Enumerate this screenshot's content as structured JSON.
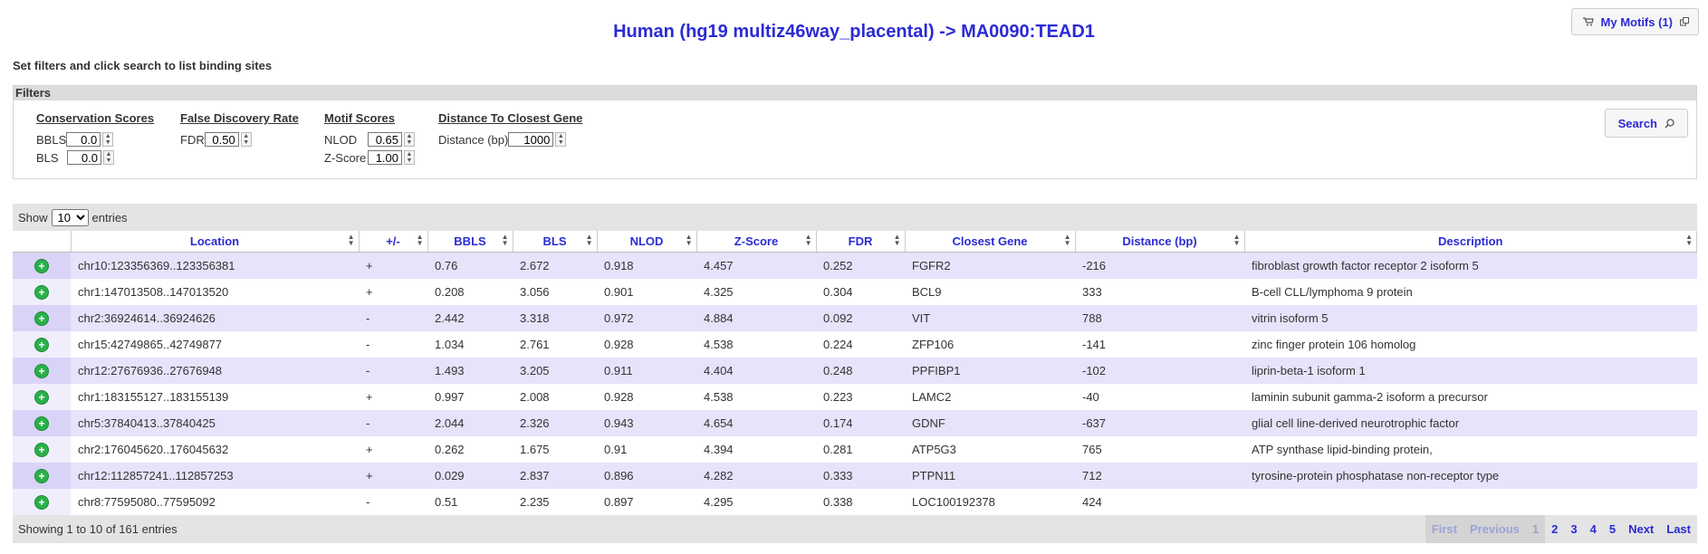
{
  "page": {
    "title": "Human (hg19 multiz46way_placental) -> MA0090:TEAD1",
    "subtitle": "Set filters and click search to list binding sites"
  },
  "my_motifs": {
    "label": "My Motifs (1)",
    "icon": "cart-icon"
  },
  "filters": {
    "header": "Filters",
    "conservation": {
      "title": "Conservation Scores",
      "bbls_label": "BBLS",
      "bbls_value": "0.0",
      "bls_label": "BLS",
      "bls_value": "0.0"
    },
    "fdr": {
      "title": "False Discovery Rate",
      "fdr_label": "FDR",
      "fdr_value": "0.50"
    },
    "motif": {
      "title": "Motif Scores",
      "nlod_label": "NLOD",
      "nlod_value": "0.65",
      "zscore_label": "Z-Score",
      "zscore_value": "1.00"
    },
    "distance": {
      "title": "Distance To Closest Gene",
      "distance_label": "Distance (bp)",
      "distance_value": "1000"
    },
    "search_label": "Search"
  },
  "table": {
    "show_label": "Show",
    "page_size": "10",
    "entries_label": "entries",
    "columns": [
      "",
      "Location",
      "+/-",
      "BBLS",
      "BLS",
      "NLOD",
      "Z-Score",
      "FDR",
      "Closest Gene",
      "Distance (bp)",
      "Description"
    ],
    "rows": [
      [
        "chr10:123356369..123356381",
        "+",
        "0.76",
        "2.672",
        "0.918",
        "4.457",
        "0.252",
        "FGFR2",
        "-216",
        "fibroblast growth factor receptor 2 isoform 5"
      ],
      [
        "chr1:147013508..147013520",
        "+",
        "0.208",
        "3.056",
        "0.901",
        "4.325",
        "0.304",
        "BCL9",
        "333",
        "B-cell CLL/lymphoma 9 protein"
      ],
      [
        "chr2:36924614..36924626",
        "-",
        "2.442",
        "3.318",
        "0.972",
        "4.884",
        "0.092",
        "VIT",
        "788",
        "vitrin isoform 5"
      ],
      [
        "chr15:42749865..42749877",
        "-",
        "1.034",
        "2.761",
        "0.928",
        "4.538",
        "0.224",
        "ZFP106",
        "-141",
        "zinc finger protein 106 homolog"
      ],
      [
        "chr12:27676936..27676948",
        "-",
        "1.493",
        "3.205",
        "0.911",
        "4.404",
        "0.248",
        "PPFIBP1",
        "-102",
        "liprin-beta-1 isoform 1"
      ],
      [
        "chr1:183155127..183155139",
        "+",
        "0.997",
        "2.008",
        "0.928",
        "4.538",
        "0.223",
        "LAMC2",
        "-40",
        "laminin subunit gamma-2 isoform a precursor"
      ],
      [
        "chr5:37840413..37840425",
        "-",
        "2.044",
        "2.326",
        "0.943",
        "4.654",
        "0.174",
        "GDNF",
        "-637",
        "glial cell line-derived neurotrophic factor"
      ],
      [
        "chr2:176045620..176045632",
        "+",
        "0.262",
        "1.675",
        "0.91",
        "4.394",
        "0.281",
        "ATP5G3",
        "765",
        "ATP synthase lipid-binding protein,"
      ],
      [
        "chr12:112857241..112857253",
        "+",
        "0.029",
        "2.837",
        "0.896",
        "4.282",
        "0.333",
        "PTPN11",
        "712",
        "tyrosine-protein phosphatase non-receptor type"
      ],
      [
        "chr8:77595080..77595092",
        "-",
        "0.51",
        "2.235",
        "0.897",
        "4.295",
        "0.338",
        "LOC100192378",
        "424",
        ""
      ]
    ],
    "info": "Showing 1 to 10 of 161 entries",
    "pager": {
      "first": "First",
      "previous": "Previous",
      "pages": [
        "1",
        "2",
        "3",
        "4",
        "5"
      ],
      "next": "Next",
      "last": "Last"
    }
  },
  "colors": {
    "accent": "#2b2bd4",
    "row_odd": "#e6e3fb",
    "add_icon": "#2ab04a"
  }
}
